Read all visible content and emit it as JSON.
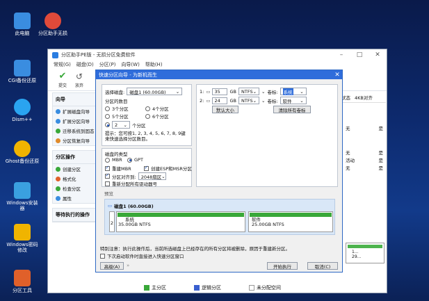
{
  "desktop": {
    "icons": [
      {
        "label": "此电脑",
        "color": "#3a8de0"
      },
      {
        "label": "分区助手无损",
        "color": "#e04a3a"
      },
      {
        "label": "CGI备份还原",
        "color": "#3a8de0"
      },
      {
        "label": "Dism++",
        "color": "#2aa4f0"
      },
      {
        "label": "Ghost备份还原",
        "color": "#f0b400"
      },
      {
        "label": "Windows安装器",
        "color": "#3aa0e0"
      },
      {
        "label": "Windows密码修改",
        "color": "#f0b400"
      },
      {
        "label": "分区工具",
        "color": "#e0602a"
      }
    ]
  },
  "window": {
    "title": "分区助手PE版 - 无损分区免费软件",
    "menu": [
      "常规(G)",
      "磁盘(D)",
      "分区(P)",
      "向导(W)",
      "帮助(H)"
    ],
    "toolbar": [
      "提交",
      "放弃"
    ],
    "left": {
      "wizard_header": "向导",
      "wizard_items": [
        "扩展磁盘向导",
        "扩展分区向导",
        "迁移系统到固态",
        "分区恢复向导"
      ],
      "ops_header": "分区操作",
      "ops_items": [
        "创建分区",
        "格式化",
        "检查分区",
        "属性"
      ],
      "pending_header": "等待执行的操作"
    },
    "table": {
      "headers": [
        "状态",
        "4KB对齐"
      ],
      "rows": [
        {
          "status": "无",
          "align": "是"
        },
        {
          "status": "无",
          "align": "是"
        },
        {
          "status": "活动",
          "align": "是"
        },
        {
          "status": "无",
          "align": "是"
        }
      ]
    },
    "mini_disk": {
      "line1": "1...",
      "line2": "29..."
    },
    "legend": [
      "主分区",
      "逻辑分区",
      "未分配空间"
    ],
    "colors": {
      "primary": "#39a839",
      "logical": "#3a5fcf",
      "unallocated": "#ffffff"
    }
  },
  "dialog": {
    "title": "快速分区向导 - 为新机而生",
    "disk_label": "选择磁盘:",
    "disk_value": "磁盘1 (60.00GB)",
    "count_label": "分区的数目",
    "counts": [
      "3个分区",
      "4个分区",
      "5个分区",
      "6个分区"
    ],
    "custom_count": "2",
    "custom_suffix": "个分区",
    "tip": "提示：您可按1, 2, 3, 4, 5, 6, 7, 8, 9键来快速选择分区数目。",
    "type_label": "磁盘的类型",
    "types": [
      "MBR",
      "GPT"
    ],
    "options": [
      "重建MBR",
      "创建ESP和MSR分区",
      "分区对齐到:",
      "重新分配所有驱动器号"
    ],
    "align_value": "2048扇区",
    "parts": [
      {
        "num": "1:",
        "size": "35",
        "unit": "GB",
        "fs": "NTFS",
        "label_caption": "卷标:",
        "label": "系统"
      },
      {
        "num": "2:",
        "size": "24",
        "unit": "GB",
        "fs": "NTFS",
        "label_caption": "卷标:",
        "label": "软件"
      }
    ],
    "default_size_btn": "默认大小",
    "clear_labels_btn": "清除所有卷标",
    "preview_label": "预览",
    "disk_header": "磁盘1 (60.00GB)",
    "disk_index": "2",
    "seg1_name": "系统",
    "seg1_size": "35.00GB NTFS",
    "seg2_name": "软件",
    "seg2_size": "25.00GB NTFS",
    "warning": "特别注意：执行此操作后，当前所选磁盘上已经存在的所有分区将被删除，原因于重建新分区。",
    "auto_run": "下次启动软件时直接进入快速分区窗口",
    "advanced_btn": "高级(A)",
    "start_btn": "开始执行",
    "cancel_btn": "取消(C)"
  }
}
